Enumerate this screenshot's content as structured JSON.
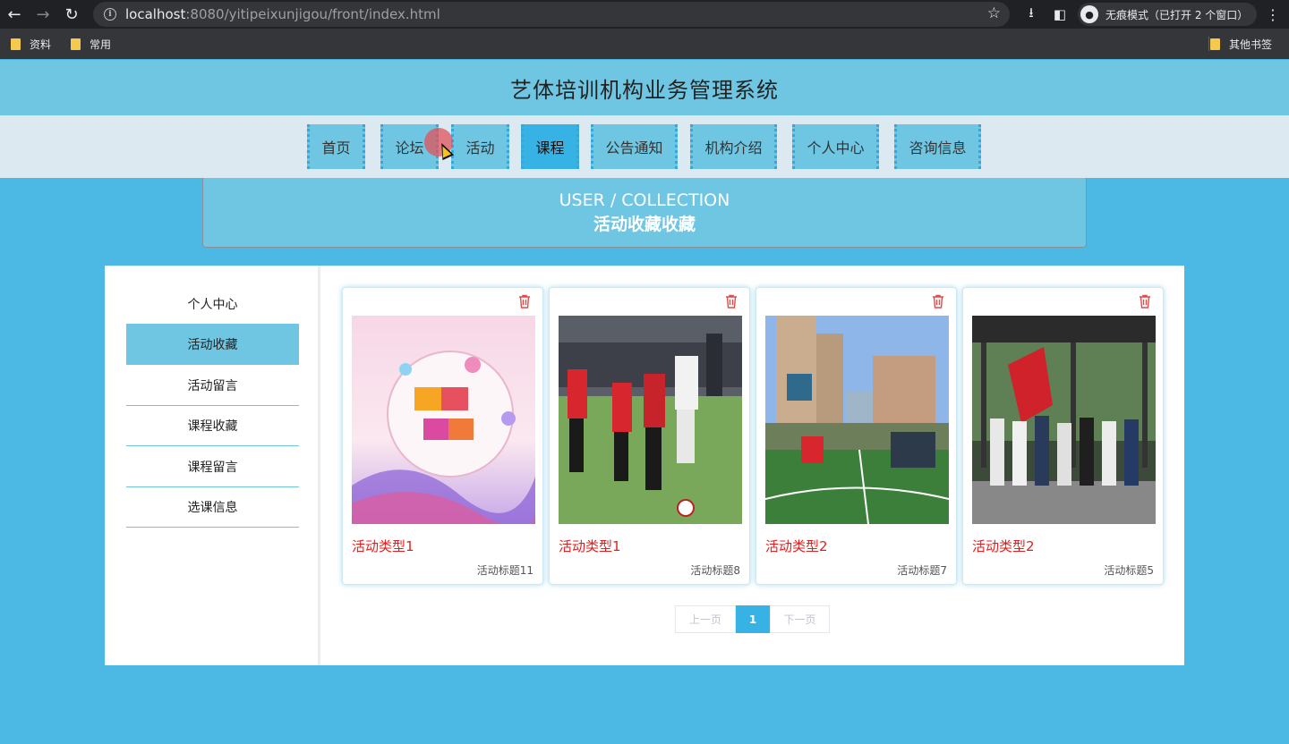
{
  "browser": {
    "url_host": "localhost",
    "url_rest": ":8080/yitipeixunjigou/front/index.html",
    "incognito_label": "无痕模式（已打开 2 个窗口）",
    "bookmarks": [
      "资料",
      "常用"
    ],
    "other_bookmarks": "其他书签"
  },
  "site": {
    "title": "艺体培训机构业务管理系统",
    "nav": [
      "首页",
      "论坛",
      "活动",
      "课程",
      "公告通知",
      "机构介绍",
      "个人中心",
      "咨询信息"
    ],
    "active_nav": "课程"
  },
  "banner": {
    "en": "USER / COLLECTION",
    "cn": "活动收藏收藏"
  },
  "sidebar": {
    "items": [
      "个人中心",
      "活动收藏",
      "活动留言",
      "课程收藏",
      "课程留言",
      "选课信息"
    ],
    "active": "活动收藏"
  },
  "cards": [
    {
      "type": "活动类型1",
      "title": "活动标题11",
      "image": "campus-art-festival-poster"
    },
    {
      "type": "活动类型1",
      "title": "活动标题8",
      "image": "kids-soccer-match"
    },
    {
      "type": "活动类型2",
      "title": "活动标题7",
      "image": "stadium-ceremony"
    },
    {
      "type": "活动类型2",
      "title": "活动标题5",
      "image": "group-photo-with-flag"
    }
  ],
  "pager": {
    "prev": "上一页",
    "current": "1",
    "next": "下一页"
  },
  "colors": {
    "accent": "#6fc6e2",
    "active": "#36b2e4",
    "danger": "#e02020"
  }
}
